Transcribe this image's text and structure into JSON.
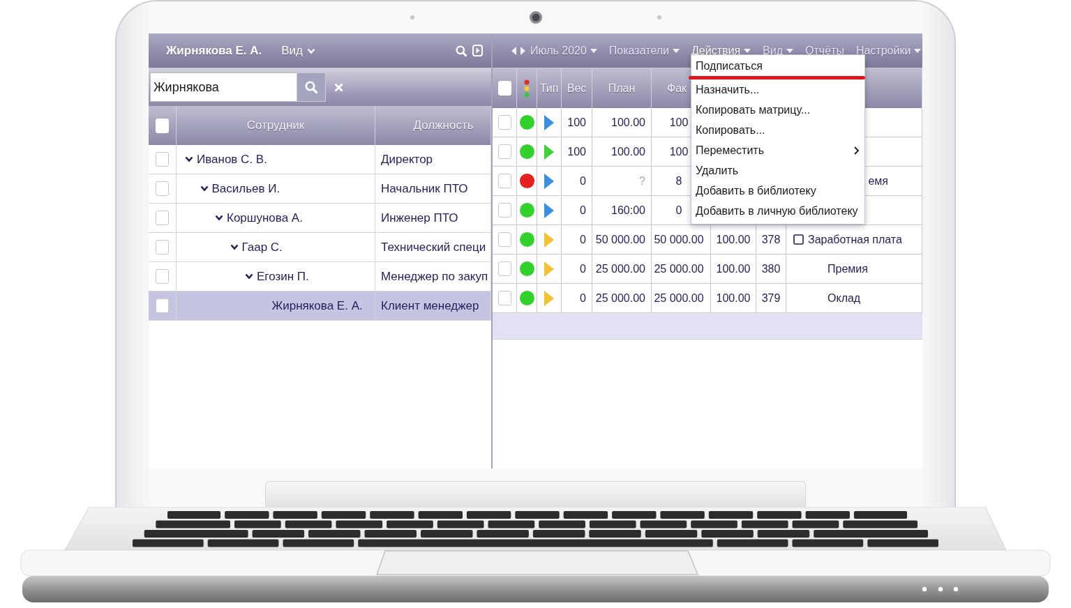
{
  "left_panel": {
    "title": "Жирнякова Е. А.",
    "view_label": "Вид",
    "search": {
      "value": "Жирнякова"
    },
    "header_checked": false,
    "columns": [
      "Сотрудник",
      "Должность"
    ],
    "employees": [
      {
        "name": "Иванов С. В.",
        "position": "Директор",
        "checked": false,
        "selected": false,
        "expanded": true,
        "children": [
          {
            "name": "Васильев И.",
            "position": "Начальник ПТО",
            "checked": false,
            "selected": false,
            "expanded": true,
            "children": [
              {
                "name": "Коршунова А.",
                "position": "Инженер ПТО",
                "checked": false,
                "selected": false,
                "expanded": true,
                "children": [
                  {
                    "name": "Гаар С.",
                    "position": "Технический специ",
                    "checked": false,
                    "selected": false,
                    "expanded": true,
                    "children": [
                      {
                        "name": "Егозин П.",
                        "position": "Менеджер по закуп",
                        "checked": false,
                        "selected": false,
                        "expanded": true,
                        "children": [
                          {
                            "name": "Жирнякова Е. А.",
                            "position": "Клиент менеджер",
                            "checked": false,
                            "selected": true
                          }
                        ]
                      }
                    ]
                  }
                ]
              }
            ]
          }
        ]
      }
    ]
  },
  "right_panel": {
    "toolbar": [
      {
        "label": "Июль 2020",
        "has_dropdown": true,
        "expanded": false
      },
      {
        "label": "Показатели",
        "has_dropdown": true,
        "expanded": false
      },
      {
        "label": "Действия",
        "has_dropdown": true,
        "expanded": true,
        "menu": [
          {
            "label": "Подписаться",
            "highlighted": true,
            "has_submenu": false
          },
          {
            "label": "Назначить...",
            "highlighted": false,
            "has_submenu": false
          },
          {
            "label": "Копировать матрицу...",
            "highlighted": false,
            "has_submenu": false
          },
          {
            "label": "Копировать...",
            "highlighted": false,
            "has_submenu": false
          },
          {
            "label": "Переместить",
            "highlighted": false,
            "has_submenu": true
          },
          {
            "label": "Удалить",
            "highlighted": false,
            "has_submenu": false
          },
          {
            "label": "Добавить в библиотеку",
            "highlighted": false,
            "has_submenu": false
          },
          {
            "label": "Добавить в личную библиотеку",
            "highlighted": false,
            "has_submenu": false
          }
        ]
      },
      {
        "label": "Вид",
        "has_dropdown": true,
        "expanded": false
      },
      {
        "label": "Отчёты",
        "has_dropdown": false,
        "expanded": false
      },
      {
        "label": "Настройки",
        "has_dropdown": true,
        "expanded": false
      }
    ],
    "header_checked": false,
    "columns": [
      "Тип",
      "Вес",
      "План",
      "Фак"
    ],
    "rows": [
      {
        "checked": false,
        "status": {
          "color": "#33d12b"
        },
        "type": {
          "color": "#3a8fde"
        },
        "weight": "100",
        "plan": "100.00",
        "plan_missing": false,
        "fact": "100"
      },
      {
        "checked": false,
        "status": {
          "color": "#33d12b"
        },
        "type": {
          "color": "#3fd23a"
        },
        "weight": "100",
        "plan": "100.00",
        "plan_missing": false,
        "fact": "100"
      },
      {
        "checked": false,
        "status": {
          "color": "#e62020"
        },
        "type": {
          "color": "#3a8fde"
        },
        "weight": "0",
        "plan": "?",
        "plan_missing": true,
        "fact": "8",
        "name": "емя"
      },
      {
        "checked": false,
        "status": {
          "color": "#33d12b"
        },
        "type": {
          "color": "#3a8fde"
        },
        "weight": "0",
        "plan": "160:00",
        "plan_missing": false,
        "fact": "0"
      },
      {
        "checked": false,
        "status": {
          "color": "#33d12b"
        },
        "type": {
          "color": "#f2c232"
        },
        "weight": "0",
        "plan": "50 000.00",
        "plan_missing": false,
        "fact": "50 000.00",
        "percent": "100.00",
        "number": "378",
        "name": "Заработная плата",
        "expanded": true,
        "children": [
          {
            "checked": false,
            "status": {
              "color": "#33d12b"
            },
            "type": {
              "color": "#f2c232"
            },
            "weight": "0",
            "plan": "25 000.00",
            "plan_missing": false,
            "fact": "25 000.00",
            "percent": "100.00",
            "number": "380",
            "name": "Премия"
          },
          {
            "checked": false,
            "status": {
              "color": "#33d12b"
            },
            "type": {
              "color": "#f2c232"
            },
            "weight": "0",
            "plan": "25 000.00",
            "plan_missing": false,
            "fact": "25 000.00",
            "percent": "100.00",
            "number": "379",
            "name": "Оклад"
          }
        ]
      }
    ]
  }
}
